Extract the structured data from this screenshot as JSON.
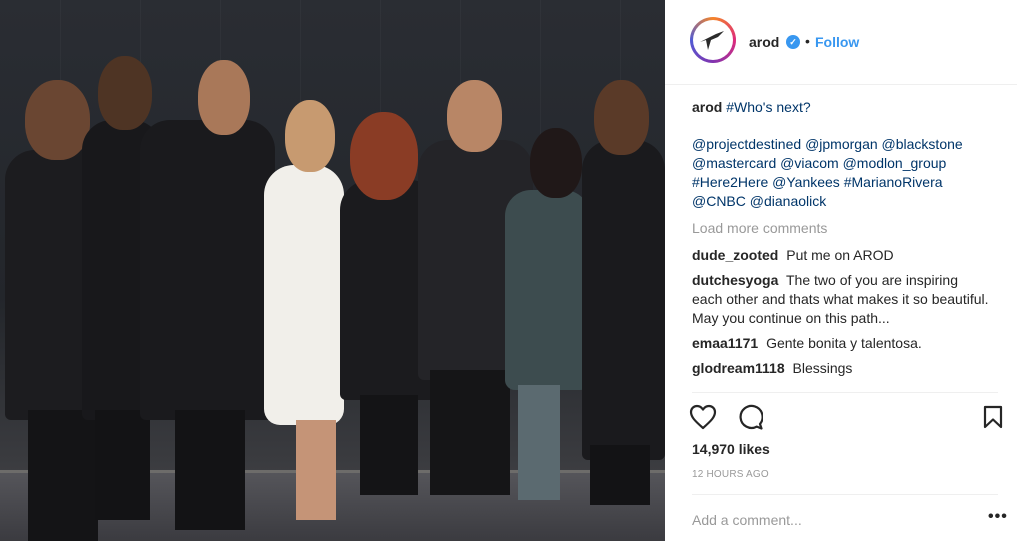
{
  "header": {
    "username": "arod",
    "verified_glyph": "✓",
    "separator": "•",
    "follow_label": "Follow"
  },
  "caption": {
    "username": "arod",
    "hashtag": "#Who's next?",
    "mentions": [
      "@projectdestined",
      "@jpmorgan",
      "@blackstone",
      "@mastercard",
      "@viacom",
      "@modlon_group",
      "#Here2Here",
      "@Yankees",
      "#MarianoRivera",
      "@CNBC",
      "@dianaolick"
    ]
  },
  "load_more": "Load more comments",
  "comments": [
    {
      "user": "dude_zooted",
      "text": "Put me on AROD"
    },
    {
      "user": "dutchesyoga",
      "text": "The two of you are inspiring each other and thats what makes it so beautiful. May you continue on this path..."
    },
    {
      "user": "emaa1171",
      "text": "Gente bonita y talentosa."
    },
    {
      "user": "glodream1118",
      "text": "Blessings"
    }
  ],
  "likes": "14,970 likes",
  "timestamp": "12 HOURS AGO",
  "add_comment_placeholder": "Add a comment...",
  "more_glyph": "•••",
  "icons": {
    "heart": "heart-icon",
    "comment": "comment-icon",
    "bookmark": "bookmark-icon",
    "avatar": "arod-logo-icon"
  },
  "colors": {
    "link": "#3897f0",
    "tag": "#003569",
    "muted": "#999999",
    "text": "#262626"
  }
}
